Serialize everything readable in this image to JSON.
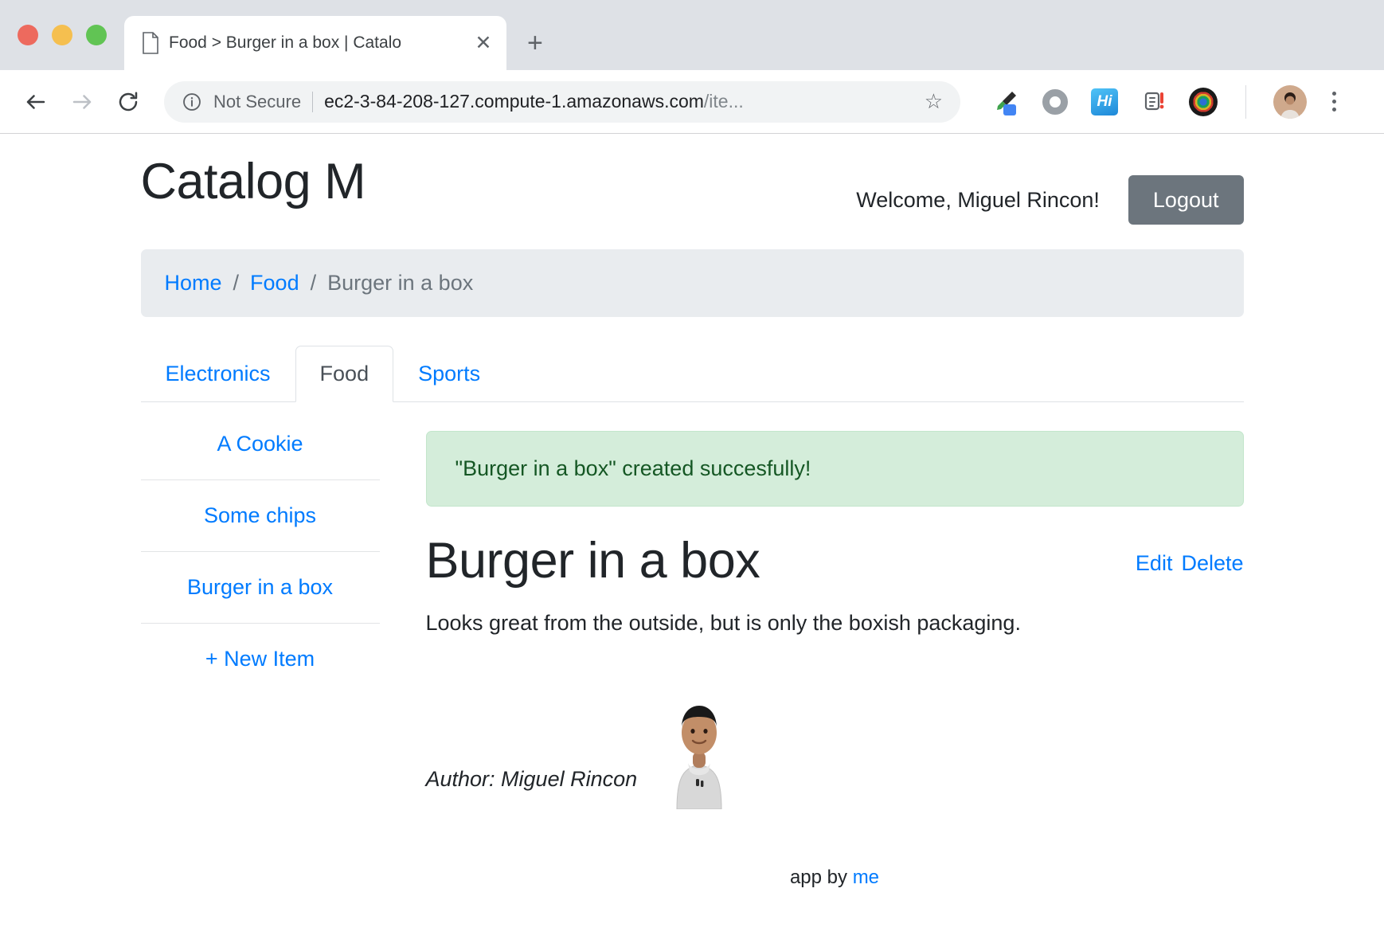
{
  "browser": {
    "tab": {
      "title": "Food > Burger in a box | Catalo",
      "favicon_icon": "page-icon",
      "close_glyph": "✕"
    },
    "new_tab_glyph": "+",
    "nav": {
      "back_icon": "arrow-left-icon",
      "forward_icon": "arrow-right-icon",
      "reload_icon": "reload-icon"
    },
    "omnibox": {
      "info_icon": "info-circle-icon",
      "security_label": "Not Secure",
      "url_main": "ec2-3-84-208-127.compute-1.amazonaws.com",
      "url_path": "/ite...",
      "star_glyph": "☆",
      "star_icon": "bookmark-star-icon"
    },
    "extensions": [
      {
        "name": "eyedropper-icon",
        "label": ""
      },
      {
        "name": "ring-icon",
        "label": ""
      },
      {
        "name": "hi-extension-icon",
        "label": "Hi"
      },
      {
        "name": "clipboard-alert-icon",
        "label": ""
      },
      {
        "name": "camera-lens-icon",
        "label": ""
      }
    ],
    "profile_icon": "profile-avatar",
    "menu_icon": "kebab-menu-icon"
  },
  "page": {
    "brand": "Catalog M",
    "welcome": "Welcome, Miguel Rincon!",
    "logout_label": "Logout",
    "breadcrumb": {
      "items": [
        {
          "label": "Home",
          "link": true
        },
        {
          "label": "Food",
          "link": true
        },
        {
          "label": "Burger in a box",
          "link": false
        }
      ],
      "separator": "/"
    },
    "tabs": [
      {
        "label": "Electronics",
        "active": false
      },
      {
        "label": "Food",
        "active": true
      },
      {
        "label": "Sports",
        "active": false
      }
    ],
    "sidebar": {
      "items": [
        {
          "label": "A Cookie"
        },
        {
          "label": "Some chips"
        },
        {
          "label": "Burger in a box"
        },
        {
          "label": "+ New Item"
        }
      ]
    },
    "alert": {
      "message": "\"Burger in a box\" created succesfully!",
      "type": "success",
      "bg": "#d4edda",
      "fg": "#155724"
    },
    "item": {
      "title": "Burger in a box",
      "edit_label": "Edit",
      "delete_label": "Delete",
      "description": "Looks great from the outside, but is only the boxish packaging.",
      "author_label": "Author: Miguel Rincon",
      "author_photo_icon": "author-portrait"
    },
    "footer": {
      "text": "app by",
      "link_label": "me"
    },
    "colors": {
      "link": "#007bff",
      "muted": "#6c757d",
      "breadcrumb_bg": "#e9ecef",
      "logout_bg": "#6c757d"
    }
  }
}
